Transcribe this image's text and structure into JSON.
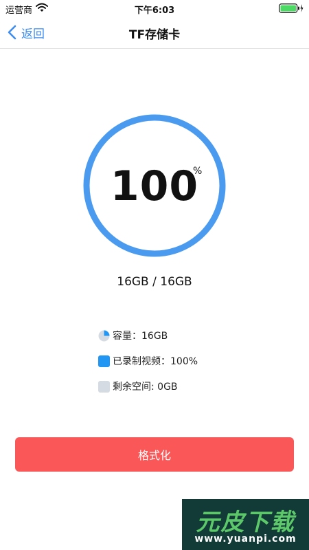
{
  "status_bar": {
    "carrier": "运营商",
    "time": "下午6:03",
    "battery_level": 1.0,
    "battery_color": "#4cd964"
  },
  "nav": {
    "back_label": "返回",
    "title": "TF存储卡"
  },
  "storage_ring": {
    "value": "100",
    "unit": "%",
    "fill_fraction": 1.0,
    "ring_color": "#4a9bf0"
  },
  "usage_summary": "16GB / 16GB",
  "legend": [
    {
      "icon": "pie-chart-icon",
      "label": "容量：16GB",
      "color": "#2196f3"
    },
    {
      "icon": "blue-square-icon",
      "label": "已录制视频：100%",
      "color": "#2196f3"
    },
    {
      "icon": "gray-square-icon",
      "label": "剩余空间: 0GB",
      "color": "#d5dbe3"
    }
  ],
  "format_button": {
    "label": "格式化",
    "color": "#fa5858"
  },
  "watermark": {
    "title": "元皮下载",
    "url": "www.yuanpi.com"
  }
}
